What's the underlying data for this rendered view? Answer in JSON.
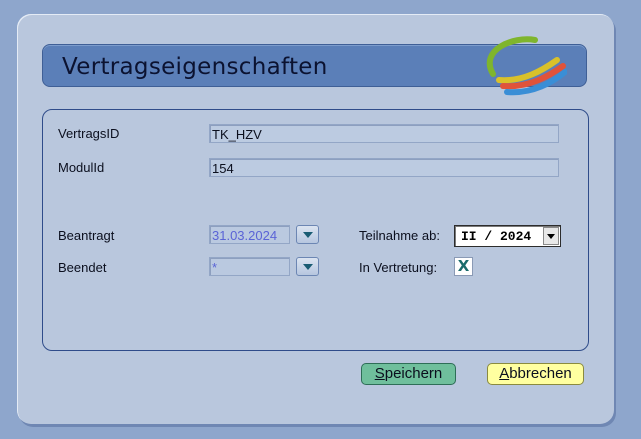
{
  "dialog": {
    "title": "Vertragseigenschaften"
  },
  "fields": {
    "vertrags_id": {
      "label": "VertragsID",
      "value": "TK_HZV"
    },
    "modul_id": {
      "label": "ModulId",
      "value": "154"
    },
    "beantragt": {
      "label": "Beantragt",
      "value": "31.03.2024"
    },
    "beendet": {
      "label": "Beendet",
      "value": "*"
    },
    "teilnahme_ab": {
      "label": "Teilnahme ab:",
      "value": "II / 2024"
    },
    "in_vertretung": {
      "label": "In Vertretung:",
      "value": "X"
    }
  },
  "buttons": {
    "save": {
      "accel": "S",
      "rest": "peichern"
    },
    "cancel": {
      "accel": "A",
      "rest": "bbrechen"
    }
  },
  "colors": {
    "background": "#8ea6cc",
    "dialog": "#b9c7dd",
    "title_bar": "#5b7fb8",
    "save_button": "#6fbf9c",
    "cancel_button": "#ffffa0"
  },
  "icons": {
    "logo": "swoosh-logo",
    "dropdown": "chevron-down-icon"
  }
}
